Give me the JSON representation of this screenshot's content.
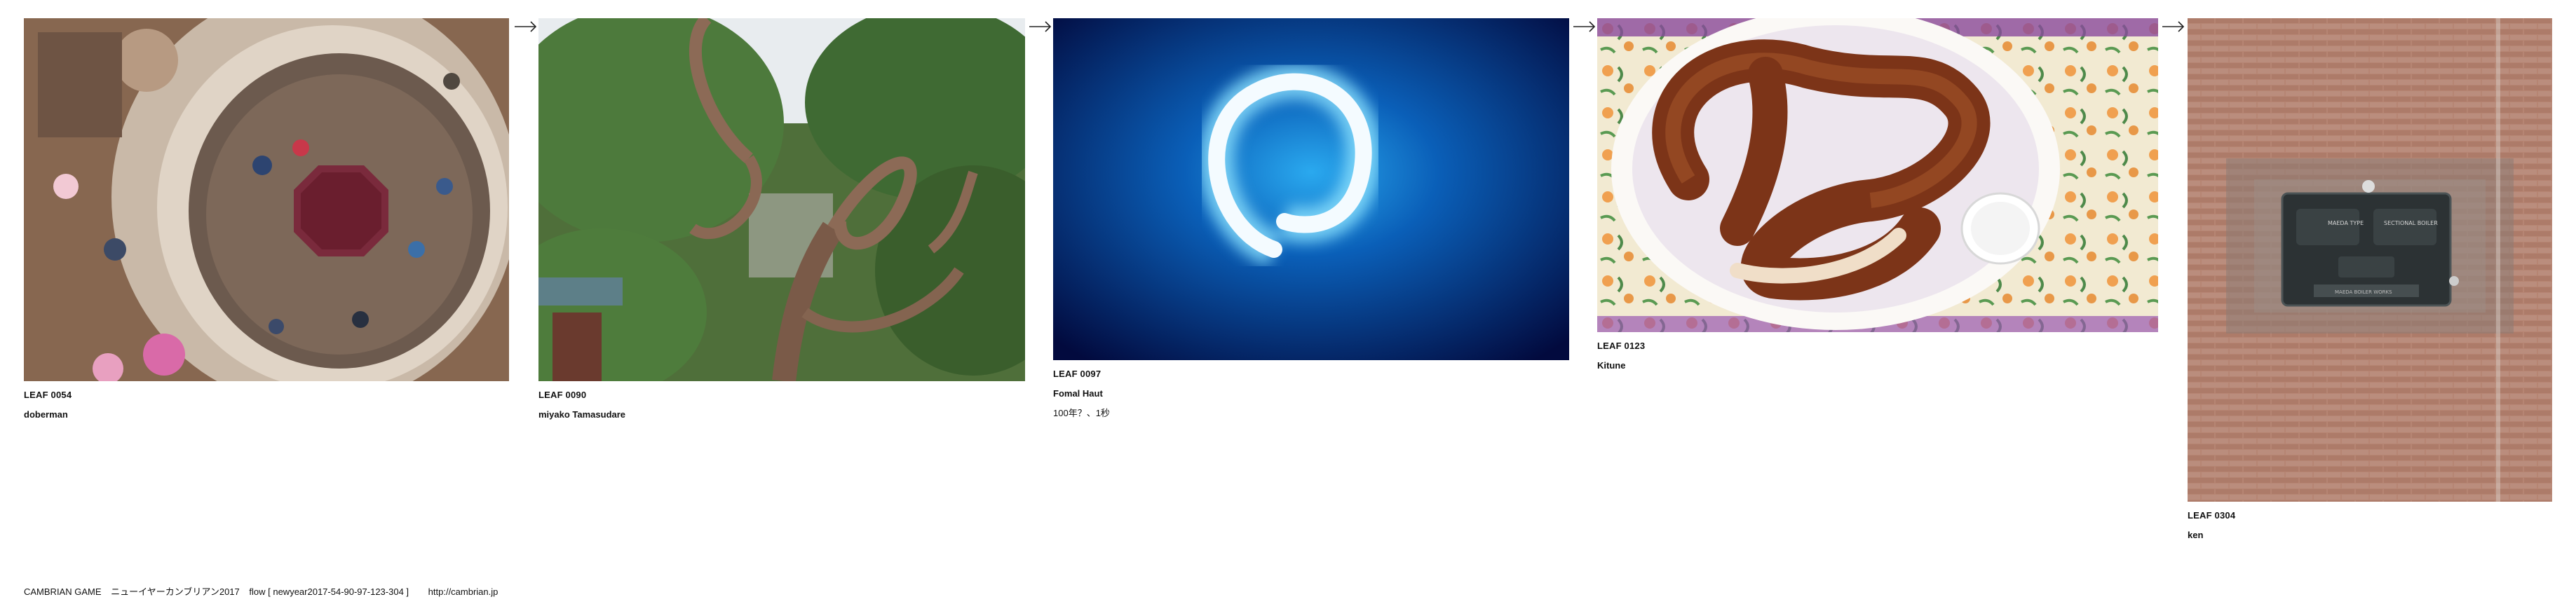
{
  "leaves": [
    {
      "id": "LEAF 0054",
      "author": "doberman"
    },
    {
      "id": "LEAF 0090",
      "author": "miyako Tamasudare"
    },
    {
      "id": "LEAF 0097",
      "author": "Fomal Haut",
      "caption": "100年？、1秒"
    },
    {
      "id": "LEAF 0123",
      "author": "Kitune"
    },
    {
      "id": "LEAF 0304",
      "author": "ken"
    }
  ],
  "plate_text": {
    "left": "MAEDA TYPE",
    "right": "SECTIONAL BOILER",
    "bottom": "MAEDA BOILER WORKS"
  },
  "footer": {
    "game": "CAMBRIAN GAME",
    "title": "ニューイヤーカンブリアン2017",
    "flow": "flow [ newyear2017-54-90-97-123-304 ]",
    "url": "http://cambrian.jp"
  },
  "colors": {
    "text": "#111111",
    "background": "#ffffff",
    "arrow": "#222222"
  }
}
